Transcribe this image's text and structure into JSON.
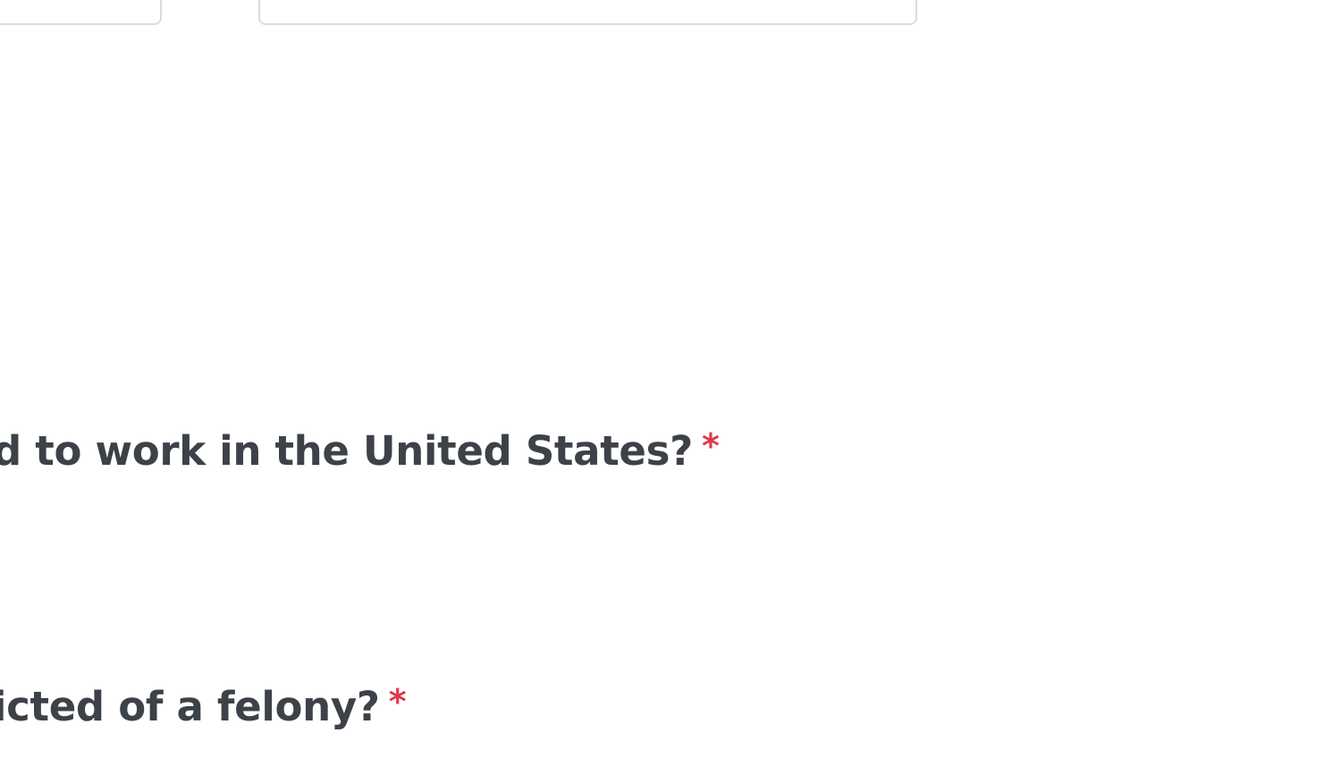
{
  "form": {
    "questions": [
      {
        "label": "d to work in the United States?",
        "required_marker": "*"
      },
      {
        "label": "icted of a felony?",
        "required_marker": "*"
      }
    ]
  },
  "colors": {
    "text": "#3d4148",
    "required": "#e0394a",
    "field_border": "#d9dbe0",
    "background": "#ffffff"
  }
}
